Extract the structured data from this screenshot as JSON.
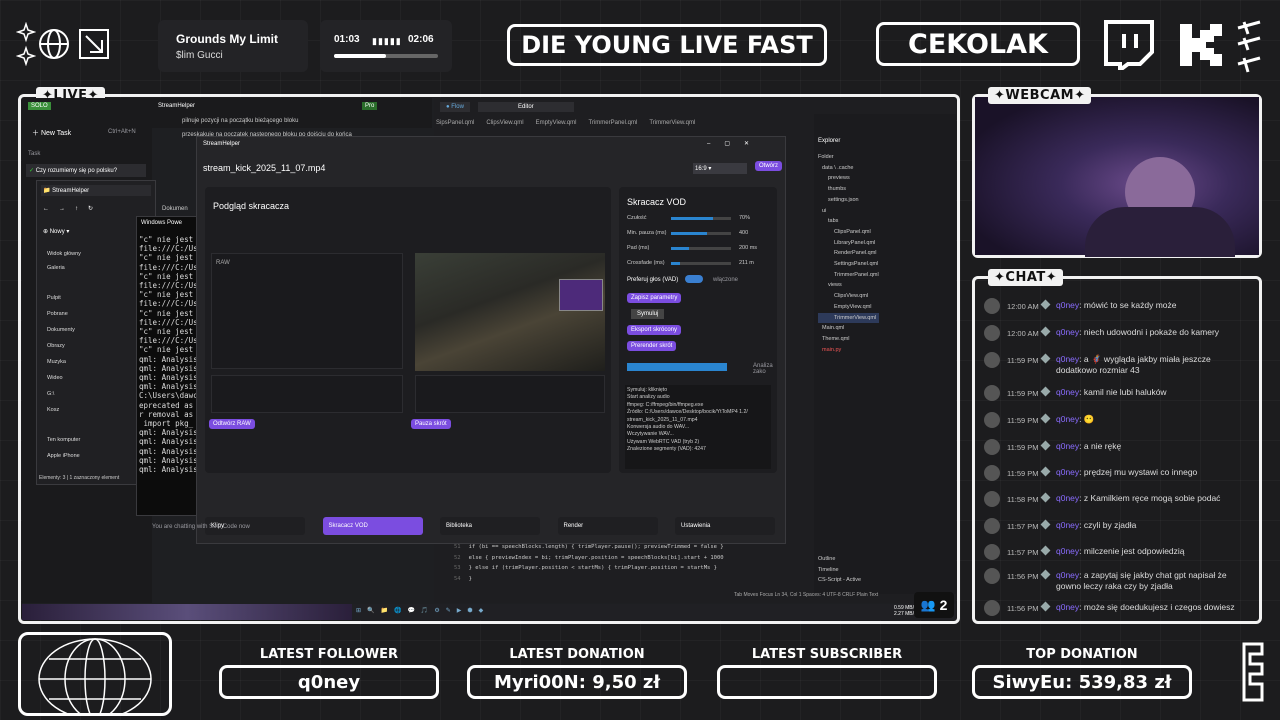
{
  "now_playing": {
    "title": "Grounds My Limit",
    "artist": "$lim Gucci",
    "elapsed": "01:03",
    "total": "02:06",
    "progress": 0.5
  },
  "banner": {
    "slogan": "DIE YOUNG LIVE FAST",
    "channel": "CEKOLAK"
  },
  "tags": {
    "live": "LIVE",
    "webcam": "WEBCAM",
    "chat": "CHAT"
  },
  "viewer_count": "2",
  "stats": [
    {
      "label": "LATEST FOLLOWER",
      "value": "q0ney"
    },
    {
      "label": "LATEST DONATION",
      "value": "Myri00N: 9,50 zł"
    },
    {
      "label": "LATEST SUBSCRIBER",
      "value": ""
    },
    {
      "label": "TOP DONATION",
      "value": "SiwyEu: 539,83 zł"
    }
  ],
  "chat": [
    {
      "time": "12:00 AM",
      "user": "q0ney",
      "text": ": mówić to se każdy może"
    },
    {
      "time": "12:00 AM",
      "user": "q0ney",
      "text": ": niech udowodni i pokaże do kamery"
    },
    {
      "time": "11:59 PM",
      "user": "q0ney",
      "text": ": a 🦸 wygląda jakby miała jeszcze dodatkowo rozmiar 43"
    },
    {
      "time": "11:59 PM",
      "user": "q0ney",
      "text": ": kamil nie lubi haluków"
    },
    {
      "time": "11:59 PM",
      "user": "q0ney",
      "text": ": 😶"
    },
    {
      "time": "11:59 PM",
      "user": "q0ney",
      "text": ": a nie rękę"
    },
    {
      "time": "11:59 PM",
      "user": "q0ney",
      "text": ": prędzej mu wystawi co innego"
    },
    {
      "time": "11:58 PM",
      "user": "q0ney",
      "text": ": z Kamilkiem ręce mogą sobie podać"
    },
    {
      "time": "11:57 PM",
      "user": "q0ney",
      "text": ": czyli by zjadła"
    },
    {
      "time": "11:57 PM",
      "user": "q0ney",
      "text": ": milczenie jest odpowiedzią"
    },
    {
      "time": "11:56 PM",
      "user": "q0ney",
      "text": ": a zapytaj się jakby chat gpt napisał że gowno leczy raka czy by zjadła"
    },
    {
      "time": "11:56 PM",
      "user": "q0ney",
      "text": ": może się doedukujesz i czegos dowiesz"
    }
  ],
  "screen": {
    "app_title": "StreamHelper",
    "new_task": "New Task",
    "new_task_shortcut": "Ctrl+Alt+N",
    "task_label": "Task",
    "task_item": "Czy rozumiemy się po polsku?",
    "explorer_title": "StreamHelper",
    "sidebar_items": [
      "Widok główny",
      "Galeria",
      "Pulpit",
      "Pobrane",
      "Dokumenty",
      "Obrazy",
      "Muzyka",
      "Wideo",
      "G:\\",
      "Kosz",
      "Ten komputer",
      "Apple iPhone"
    ],
    "explorer_status": "Elementy: 3 | 1 zaznaczony element",
    "new_btn": "Nowy",
    "doc_path": "Dokumen",
    "powershell_title": "Windows Powe",
    "terminal_lines": [
      "\"c\" nie jest",
      "file:///C:/Us",
      "\"c\" nie jest",
      "file:///C:/Us",
      "\"c\" nie jest",
      "file:///C:/Us",
      "\"c\" nie jest",
      "file:///C:/Us",
      "\"c\" nie jest",
      "file:///C:/Us",
      "\"c\" nie jest",
      "file:///C:/Us",
      "\"c\" nie jest",
      "qml: Analysis",
      "qml: Analysis",
      "qml: Analysis",
      "qml: Analysis",
      "C:\\Users\\dawc",
      "eprecated as",
      "r removal as",
      " import pkg_",
      "qml: Analysis",
      "qml: Analysis",
      "qml: Analysis",
      "qml: Analysis",
      "qml: Analysis"
    ],
    "notes": [
      "pilnuje pozycji na początku bieżącego bloku",
      "przeskakuje na początek następnego bloku po dojściu do końca"
    ],
    "helper_window_title": "StreamHelper",
    "file_name": "stream_kick_2025_11_07.mp4",
    "aspect": "16:9",
    "open_btn": "Otwórz",
    "preview_title": "Podgląd skracacza",
    "raw_label": "RAW",
    "play_raw": "Odtwórz RAW",
    "pause_short": "Pauza skrót",
    "cutter_title": "Skracacz VOD",
    "params": [
      {
        "label": "Czułość",
        "value": "70%",
        "fill": 0.7
      },
      {
        "label": "Min. pauza (ms)",
        "value": "400",
        "fill": 0.6
      },
      {
        "label": "Pad (ms)",
        "value": "200 ms",
        "fill": 0.3
      },
      {
        "label": "Crossfade (ms)",
        "value": "211 m",
        "fill": 0.15
      }
    ],
    "vad_label": "Preferuj głos (VAD)",
    "vad_state": "włączone",
    "buttons": [
      "Zapisz parametry",
      "Symuluj",
      "Eksport skrócony",
      "Prerender skrót"
    ],
    "analysis_label": "Analiza zako",
    "log": [
      "Symuluj: kliknięto",
      "Start analizy audio",
      "ffmpeg: C:/ffmpeg/bin/ffmpeg.exe",
      "Źródło: C:/Users/dawce/Desktop/bocik/YtToMP4 1.2/",
      "stream_kick_2025_11_07.mp4",
      "Konwersja audio do WAV...",
      "Wczytywanie WAV...",
      "Używam WebRTC VAD (tryb 2)",
      "Znalezione segmenty (VAD): 4247"
    ],
    "tabs": [
      "Klipy",
      "Skracacz VOD",
      "Biblioteka",
      "Render",
      "Ustawienia"
    ],
    "ide_tabs": [
      "Flow",
      "Editor"
    ],
    "file_tabs": [
      "SipsPanel.qml",
      "ClipsView.qml",
      "EmptyView.qml",
      "TrimmerPanel.qml",
      "TrimmerView.qml"
    ],
    "explorer_label": "Explorer",
    "tree": [
      "Folder",
      "data \\ .cache",
      "previews",
      "thumbs",
      "settings.json",
      "ui",
      "tabs",
      "ClipsPanel.qml",
      "LibraryPanel.qml",
      "RenderPanel.qml",
      "SettingsPanel.qml",
      "TrimmerPanel.qml",
      "views",
      "ClipsView.qml",
      "EmptyView.qml",
      "TrimmerView.qml",
      "Main.qml",
      "Theme.qml",
      "main.py"
    ],
    "outline": [
      "Outline",
      "Timeline",
      "CS-Script - Active"
    ],
    "code": [
      {
        "n": "51",
        "t": "if (bi == speechBlocks.length) { trimPlayer.pause(); previewTrimmed = false }"
      },
      {
        "n": "52",
        "t": "else { previewIndex = bi; trimPlayer.position = speechBlocks[bi].start + 1000"
      },
      {
        "n": "53",
        "t": "} else if (trimPlayer.position < startMs) { trimPlayer.position = startMs }"
      },
      {
        "n": "54",
        "t": "}"
      }
    ],
    "status_right": "Tab Moves Focus   Ln 34, Col 1   Spaces: 4   UTF-8   CRLF   Plain Text",
    "chat_input": "You are chatting with Solo Code now",
    "net": "0.59 MB/s\n2.27 MB/s",
    "pro": "Pro",
    "solo": "SOLO"
  }
}
